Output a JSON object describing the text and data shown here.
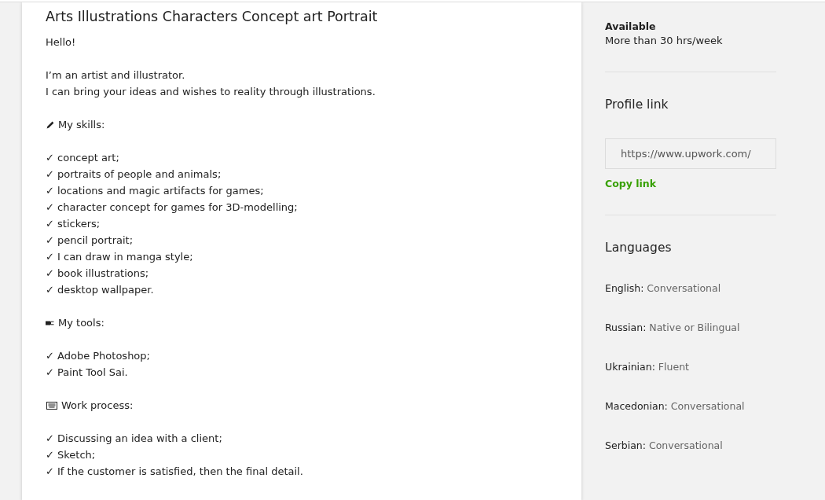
{
  "card": {
    "title": "Arts Illustrations Characters Concept art Portrait",
    "intro": [
      {
        "lines": [
          "Hello!"
        ]
      },
      {
        "lines": [
          "I’m an artist and illustrator.",
          "I can bring your ideas and wishes to reality through illustrations."
        ]
      }
    ],
    "sections": [
      {
        "heading": "My skills:",
        "items": [
          "✓ concept art;",
          "✓ portraits of people and animals;",
          "✓ locations and magic artifacts for games;",
          "✓ character concept for games for 3D-modelling;",
          "✓ stickers;",
          "✓ pencil portrait;",
          "✓ I can draw in manga style;",
          "✓ book illustrations;",
          "✓ desktop wallpaper."
        ]
      },
      {
        "heading": "My tools:",
        "items": [
          "✓ Adobe Photoshop;",
          "✓ Paint Tool Sai."
        ]
      },
      {
        "heading": "Work process:",
        "items": [
          "✓ Discussing an idea with a client;",
          "✓ Sketch;",
          "✓ If the customer is satisfied, then the final detail."
        ]
      }
    ]
  },
  "sidebar": {
    "availability": {
      "label": "Available",
      "value": "More than 30 hrs/week"
    },
    "profile_link": {
      "title": "Profile link",
      "url": "https://www.upwork.com/",
      "action": "Copy link"
    },
    "languages": {
      "title": "Languages",
      "items": [
        {
          "name": "English:",
          "proficiency": "Conversational"
        },
        {
          "name": "Russian:",
          "proficiency": "Native or Bilingual"
        },
        {
          "name": "Ukrainian:",
          "proficiency": "Fluent"
        },
        {
          "name": "Macedonian:",
          "proficiency": "Conversational"
        },
        {
          "name": "Serbian:",
          "proficiency": "Conversational"
        }
      ]
    }
  }
}
